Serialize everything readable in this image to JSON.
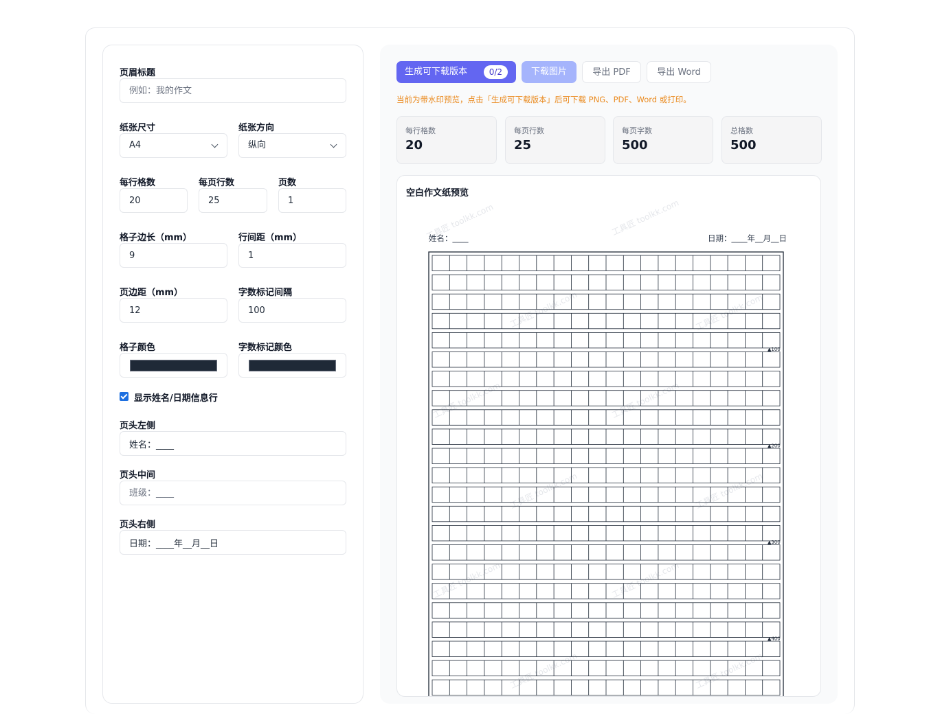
{
  "form": {
    "header_title": {
      "label": "页眉标题",
      "value": "",
      "placeholder": "例如：我的作文"
    },
    "paper_size": {
      "label": "纸张尺寸",
      "value": "A4"
    },
    "orientation": {
      "label": "纸张方向",
      "value": "纵向"
    },
    "cells_per_row": {
      "label": "每行格数",
      "value": "20"
    },
    "rows_per_page": {
      "label": "每页行数",
      "value": "25"
    },
    "pages": {
      "label": "页数",
      "value": "1"
    },
    "cell_size": {
      "label": "格子边长（mm）",
      "value": "9"
    },
    "line_spacing": {
      "label": "行间距（mm）",
      "value": "1"
    },
    "margin": {
      "label": "页边距（mm）",
      "value": "12"
    },
    "count_mark_interval": {
      "label": "字数标记间隔",
      "value": "100"
    },
    "grid_color": {
      "label": "格子颜色",
      "color": "#1f2937"
    },
    "mark_color": {
      "label": "字数标记颜色",
      "color": "#1f2937"
    },
    "show_info_row": {
      "label": "显示姓名/日期信息行",
      "checked": true
    },
    "header_left": {
      "label": "页头左侧",
      "value": "姓名：____",
      "placeholder": ""
    },
    "header_center": {
      "label": "页头中间",
      "value": "",
      "placeholder": "班级：____"
    },
    "header_right": {
      "label": "页头右侧",
      "value": "日期：____年__月__日",
      "placeholder": ""
    }
  },
  "toolbar": {
    "generate_label": "生成可下载版本",
    "generate_badge": "0/2",
    "download_image_label": "下载图片",
    "export_pdf_label": "导出 PDF",
    "export_word_label": "导出 Word"
  },
  "notice": "当前为带水印预览，点击「生成可下载版本」后可下载 PNG、PDF、Word 或打印。",
  "stats": [
    {
      "title": "每行格数",
      "value": "20"
    },
    {
      "title": "每页行数",
      "value": "25"
    },
    {
      "title": "每页字数",
      "value": "500"
    },
    {
      "title": "总格数",
      "value": "500"
    }
  ],
  "preview": {
    "title": "空白作文纸预览",
    "header_left": "姓名：____",
    "header_right": "日期：____年__月__日",
    "watermark": "工具匠 toolkk.com",
    "grid_cols": 20,
    "grid_rows": 25,
    "marks": [
      "▲100",
      "▲200",
      "▲300",
      "▲400"
    ],
    "accent": "#1f2937"
  }
}
